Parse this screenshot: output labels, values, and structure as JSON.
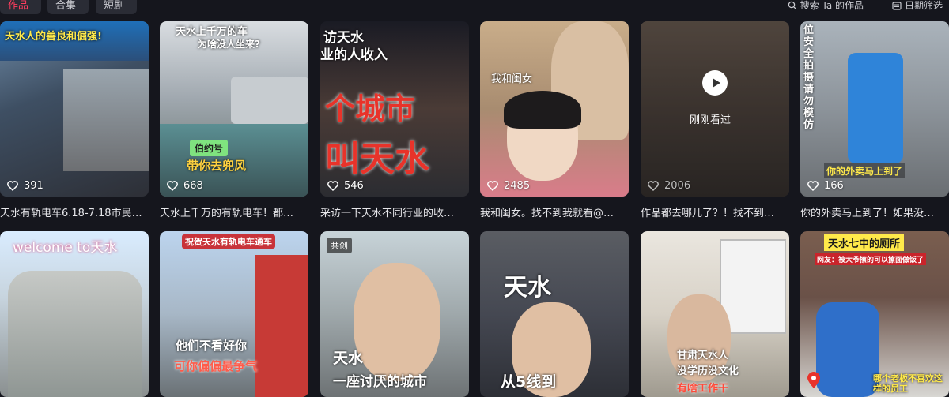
{
  "tabs": [
    {
      "label": "作品",
      "active": true
    },
    {
      "label": "合集",
      "active": false
    },
    {
      "label": "短剧",
      "active": false
    }
  ],
  "search": {
    "label": "搜索 Ta 的作品",
    "icon": "search-icon"
  },
  "filter": {
    "label": "日期筛选",
    "icon": "calendar-icon"
  },
  "videos": [
    {
      "likes": "391",
      "caption": "天水有轨电车6.18-7.18市民…",
      "overlay_top": "天水人的善良和倔强!",
      "overlay_top2": "",
      "overlay_bottom": ""
    },
    {
      "likes": "668",
      "caption": "天水上千万的有轨电车！都…",
      "overlay_top": "天水上千万的车",
      "overlay_top2": "为啥没人坐来?",
      "overlay_mid": "伯约号",
      "overlay_bottom": "带你去兜风"
    },
    {
      "likes": "546",
      "caption": "采访一下天水不同行业的收…",
      "overlay_top": "访天水",
      "overlay_top2": "业的人收入",
      "overlay_mid": "个城市",
      "overlay_bottom": "叫天水"
    },
    {
      "likes": "2485",
      "caption": "我和闺女。找不到我就看@…",
      "overlay_top": "我和闺女"
    },
    {
      "likes": "2006",
      "caption": "作品都去哪儿了？！找不到…",
      "overlay_top": "刚刚看过",
      "dim": true
    },
    {
      "likes": "166",
      "caption": "你的外卖马上到了！如果没…",
      "overlay_top": "位安全拍摄请勿模仿",
      "overlay_bottom": "你的外卖马上到了"
    },
    {
      "overlay_top": "welcome to天水"
    },
    {
      "overlay_top": "祝贺天水有轨电车通车",
      "overlay_bottom": "他们不看好你",
      "overlay_bottom2": "可你偏偏最争气"
    },
    {
      "badge": "共创",
      "overlay_bottom": "天水",
      "overlay_bottom2": "一座讨厌的城市"
    },
    {
      "overlay_top": "天水",
      "overlay_bottom": "从5线到"
    },
    {
      "overlay_bottom": "甘肃天水人",
      "overlay_bottom2": "没学历没文化",
      "overlay_bottom3": "有啥工作干"
    },
    {
      "overlay_top": "天水七中的厕所",
      "overlay_top2": "网友：被大爷擦的可以擦面做饭了",
      "overlay_bottom": "哪个老板不喜欢这样的员工"
    }
  ]
}
